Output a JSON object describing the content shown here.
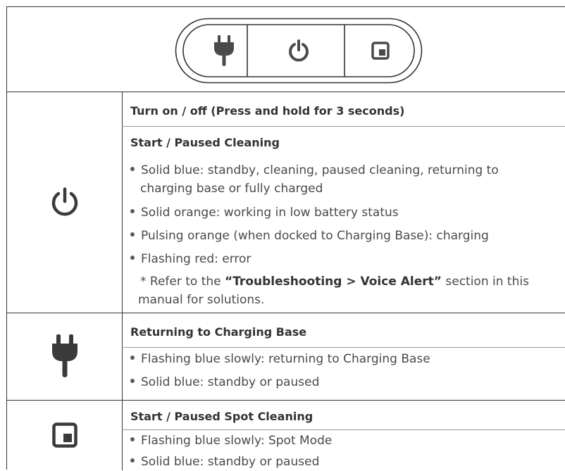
{
  "sections": [
    {
      "icon": "power-icon",
      "headings": [
        "Turn on / off (Press and hold for 3 seconds)",
        "Start / Paused Cleaning"
      ],
      "bullets": [
        {
          "line1": "Solid blue: standby, cleaning, paused cleaning, returning to",
          "line2": "charging base or fully charged"
        },
        {
          "line1": "Solid orange: working in low battery status"
        },
        {
          "line1": "Pulsing orange (when docked to Charging Base): charging"
        },
        {
          "line1": "Flashing red: error"
        }
      ],
      "note": {
        "prefix": "* Refer to the ",
        "bold": "“Troubleshooting > Voice Alert”",
        "suffix": " section in this",
        "line2": "manual for solutions."
      }
    },
    {
      "icon": "plug-icon",
      "heading": "Returning to Charging Base",
      "bullets": [
        "Flashing blue slowly: returning to Charging Base",
        "Solid blue: standby or paused"
      ]
    },
    {
      "icon": "spot-cleaning-icon",
      "heading": "Start / Paused Spot Cleaning",
      "bullets": [
        "Flashing blue slowly: Spot Mode",
        "Solid blue: standby or paused"
      ]
    }
  ]
}
